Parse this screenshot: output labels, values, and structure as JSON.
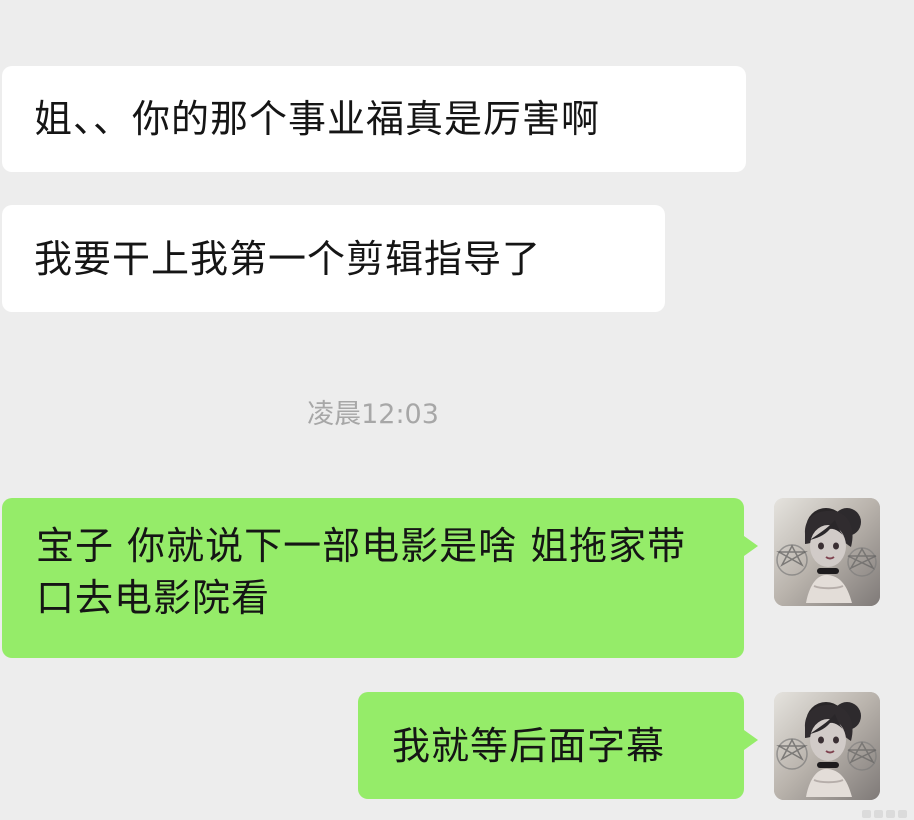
{
  "messages": [
    {
      "text": "姐、、你的那个事业福真是厉害啊"
    },
    {
      "text": "我要干上我第一个剪辑指导了"
    }
  ],
  "timestamp": "凌晨12:03",
  "outgoing": [
    {
      "text": "宝子 你就说下一部电影是啥 姐拖家带口去电影院看"
    },
    {
      "text": "我就等后面字幕"
    }
  ],
  "colors": {
    "background": "#ededed",
    "incoming_bubble": "#ffffff",
    "outgoing_bubble": "#95ec69",
    "text": "#151515",
    "timestamp": "#a7a7a7"
  },
  "icons": {
    "avatar": "anime-girl-avatar-icon"
  }
}
